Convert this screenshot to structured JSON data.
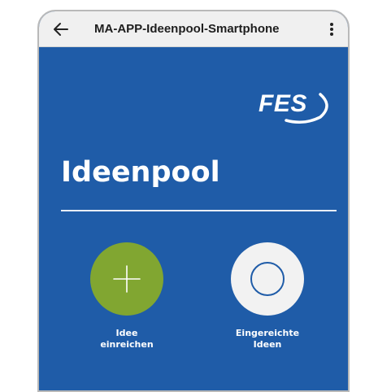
{
  "appbar": {
    "title": "MA-APP-Ideenpool-Smartphone",
    "back_icon": "arrow-left-icon",
    "menu_icon": "more-vertical-icon"
  },
  "logo": {
    "text": "FES"
  },
  "page": {
    "title": "Ideenpool"
  },
  "actions": [
    {
      "line1": "Idee",
      "line2": "einreichen",
      "icon": "plus-icon",
      "color": "#81a631"
    },
    {
      "line1": "Eingereichte",
      "line2": "Ideen",
      "icon": "circle-outline-icon",
      "color": "#f2f2f2"
    }
  ],
  "colors": {
    "background": "#1f5ca8",
    "appbar": "#f0f0f0",
    "accent_green": "#81a631"
  }
}
